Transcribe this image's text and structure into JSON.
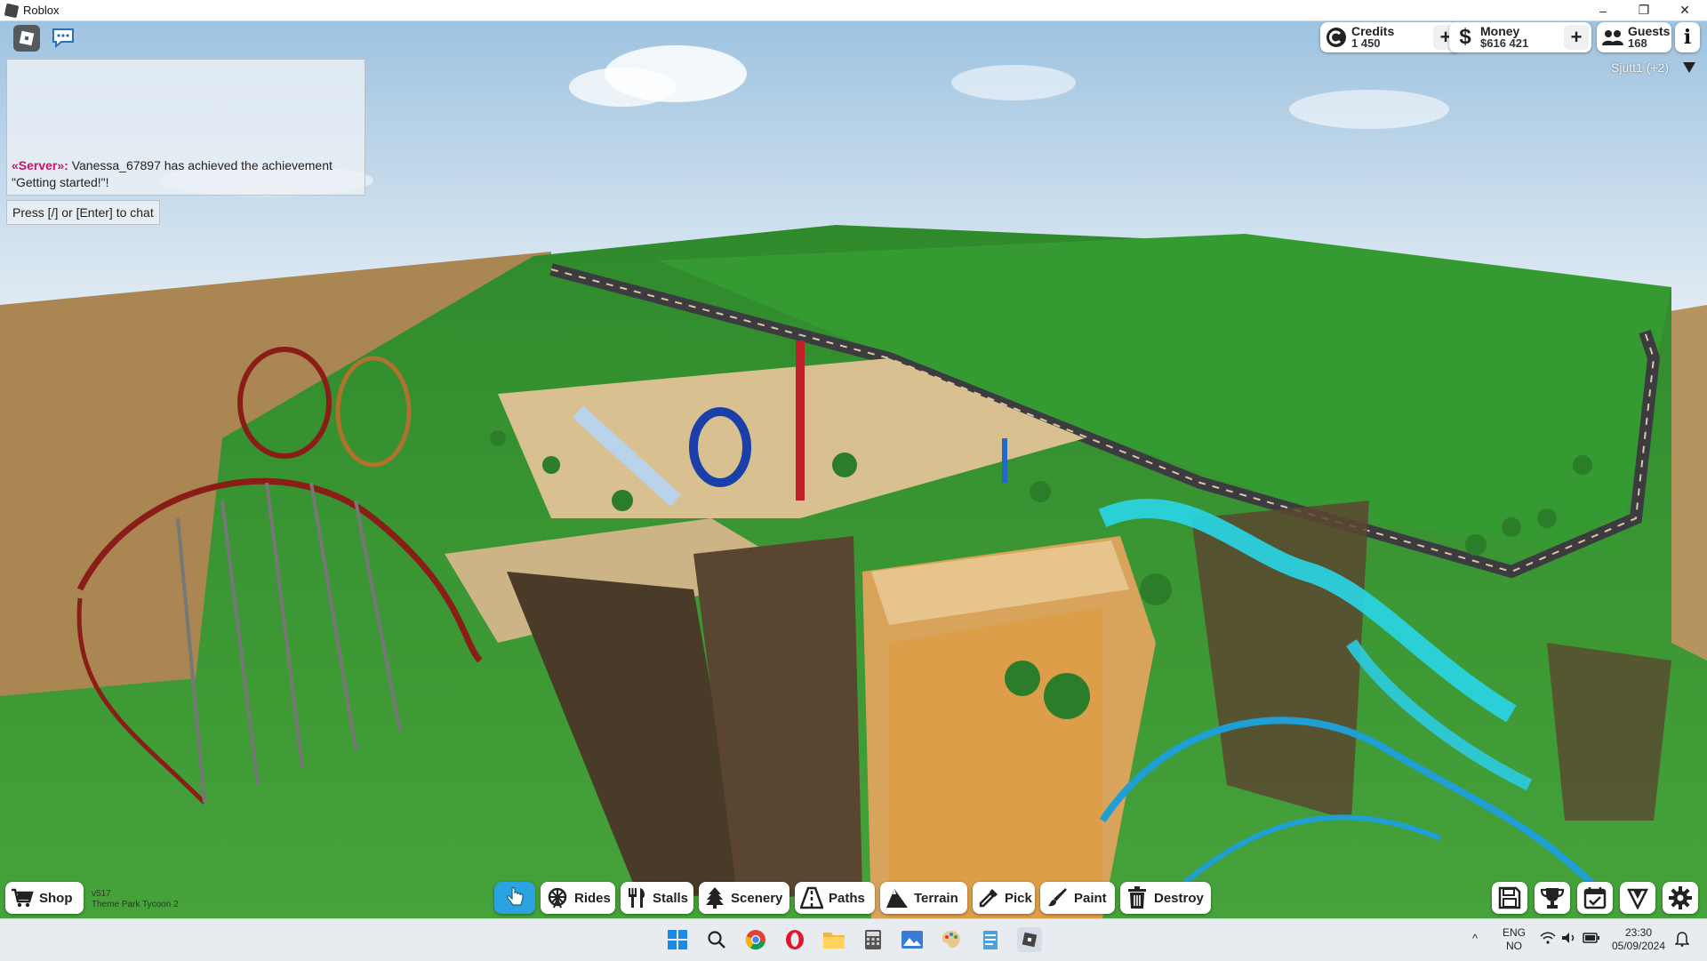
{
  "window": {
    "title": "Roblox",
    "minimize": "–",
    "restore": "❐",
    "close": "✕"
  },
  "chat": {
    "server_tag": "«Server»:",
    "message": " Vanessa_67897 has achieved the achievement \"Getting started!\"!",
    "input_hint": "Press [/] or [Enter] to chat"
  },
  "stats": {
    "credits": {
      "label": "Credits",
      "value": "1 450"
    },
    "money": {
      "label": "Money",
      "value": "$616 421"
    },
    "guests": {
      "label": "Guests",
      "value": "168"
    }
  },
  "player_tag": "Sjutt1 (+2)",
  "toolbar": {
    "shop": "Shop",
    "rides": "Rides",
    "stalls": "Stalls",
    "scenery": "Scenery",
    "paths": "Paths",
    "terrain": "Terrain",
    "pick": "Pick",
    "paint": "Paint",
    "destroy": "Destroy"
  },
  "version": {
    "number": "v517",
    "game": "Theme Park Tycoon 2"
  },
  "taskbar": {
    "lang_top": "ENG",
    "lang_bottom": "NO",
    "time": "23:30",
    "date": "05/09/2024"
  },
  "colors": {
    "accent": "#2ba3e0",
    "server_tag": "#c4146e",
    "grass": "#3f9a36",
    "sand": "#b08a52",
    "sky": "#c9dcea"
  }
}
